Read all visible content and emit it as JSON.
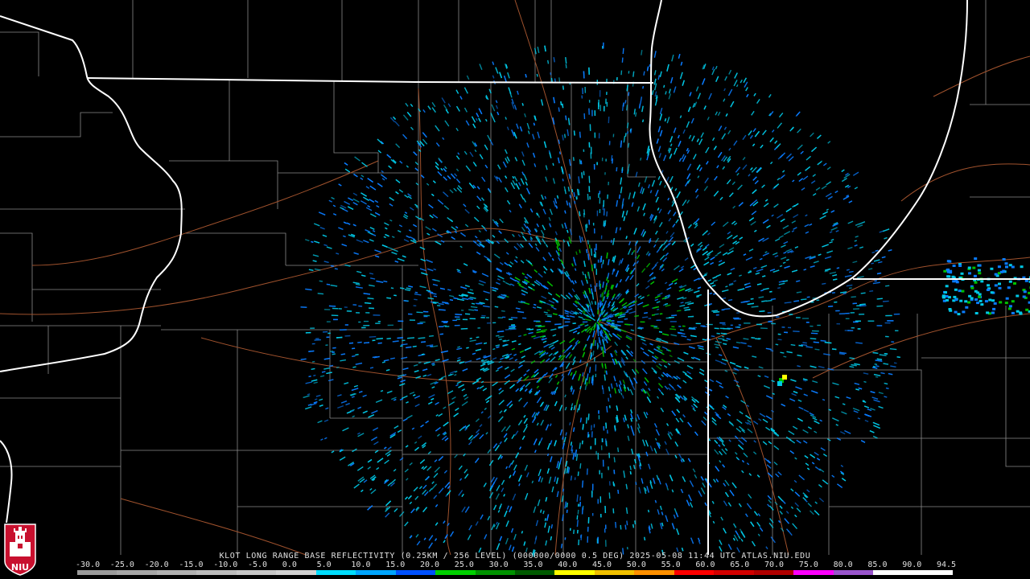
{
  "caption": "KLOT LONG RANGE BASE REFLECTIVITY (0.25KM / 256 LEVEL) (000000/0000 0.5 DEG) 2025-05-08 11:44 UTC  ATLAS.NIU.EDU",
  "logo": {
    "text": "NIU",
    "icon": "university-tower-icon",
    "color": "#c8102e"
  },
  "scale": {
    "labels": [
      "-30.0",
      "-25.0",
      "-20.0",
      "-15.0",
      "-10.0",
      "-5.0",
      "0.0",
      "5.0",
      "10.0",
      "15.0",
      "20.0",
      "25.0",
      "30.0",
      "35.0",
      "40.0",
      "45.0",
      "50.0",
      "55.0",
      "60.0",
      "65.0",
      "70.0",
      "75.0",
      "80.0",
      "85.0",
      "90.0",
      "94.5"
    ],
    "colors": [
      "#9a9a9a",
      "#a5a5a5",
      "#b0b0b0",
      "#bbbbbb",
      "#c6c6c6",
      "#d1d1d1",
      "#00ddff",
      "#00a5ff",
      "#0050ff",
      "#00d000",
      "#009200",
      "#005a00",
      "#ffff00",
      "#f0c000",
      "#ff9000",
      "#ff0000",
      "#d20000",
      "#b00000",
      "#ff00ff",
      "#9955cc",
      "#ffffff",
      "#ffffff"
    ]
  },
  "colors": {
    "background": "#000000",
    "state_lines": "#ffffff",
    "county_lines": "#8a8a8a",
    "highways": "#a0522d",
    "echo_light": "#00c8e6",
    "echo_mid": "#0a7cff",
    "echo_strong": "#00c000"
  }
}
